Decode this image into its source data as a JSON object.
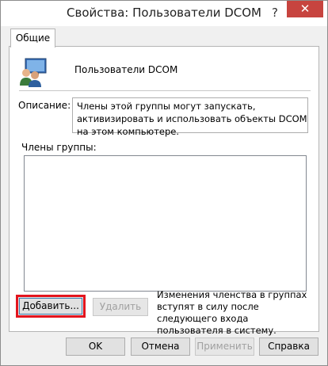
{
  "window": {
    "title": "Свойства: Пользователи DCOM",
    "help_symbol": "?",
    "close_symbol": "✕"
  },
  "tabs": [
    {
      "label": "Общие"
    }
  ],
  "general": {
    "group_name": "Пользователи DCOM",
    "description_label": "Описание:",
    "description_text": "Члены этой группы могут запускать, активизировать и использовать объекты DCOM на этом компьютере.",
    "members_label": "Члены группы:",
    "members": [],
    "add_button": "Добавить...",
    "remove_button": "Удалить",
    "note": "Изменения членства в группах вступят в силу после следующего входа пользователя в систему."
  },
  "footer": {
    "ok": "OK",
    "cancel": "Отмена",
    "apply": "Применить",
    "help": "Справка"
  },
  "colors": {
    "highlight": "#e3151e",
    "close_button": "#c7443f"
  }
}
